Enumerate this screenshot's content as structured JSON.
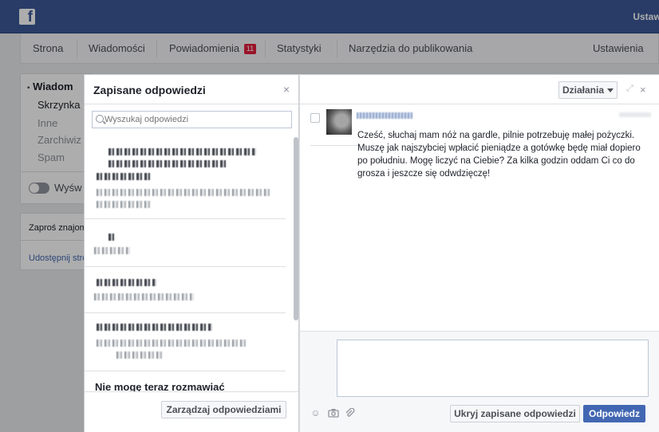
{
  "topbar": {
    "settings_label": "Ustawi",
    "logo_letter": "f"
  },
  "nav": {
    "items": [
      {
        "label": "Strona"
      },
      {
        "label": "Wiadomości"
      },
      {
        "label": "Powiadomienia",
        "badge": "11"
      },
      {
        "label": "Statystyki"
      },
      {
        "label": "Narzędzia do publikowania"
      },
      {
        "label": "Ustawienia"
      }
    ]
  },
  "sidebar": {
    "title": "Wiadom",
    "items": [
      "Skrzynka",
      "Inne",
      "Zarchiwiz",
      "Spam"
    ],
    "toggle_label": "Wyśw",
    "invite_label": "Zaproś znajom",
    "share_label": "Udostępnij stro"
  },
  "saved_replies": {
    "title": "Zapisane odpowiedzi",
    "close_icon": "×",
    "search_placeholder": "Wyszukaj odpowiedzi",
    "last_item_title": "Nie mogę teraz rozmawiać",
    "manage_button": "Zarządzaj odpowiedziami"
  },
  "conversation": {
    "actions_button": "Działania",
    "close_icon": "×",
    "expand_icon": "⤢",
    "message_lines": [
      "Cześć, słuchaj mam nóż na gardle, pilnie potrzebuję małej pożyczki.",
      "Muszę jak najszybciej wpłacić pieniądze a gotówkę będę miał dopiero",
      "po południu. Mogę liczyć na Ciebie? Za kilka godzin oddam Ci co do",
      "grosza i jeszcze się odwdzięczę!"
    ],
    "hide_saved_button": "Ukryj zapisane odpowiedzi",
    "reply_button": "Odpowiedz"
  },
  "colors": {
    "brand": "#3b5998",
    "primary_button": "#4267b2",
    "badge": "#e41e3f"
  }
}
